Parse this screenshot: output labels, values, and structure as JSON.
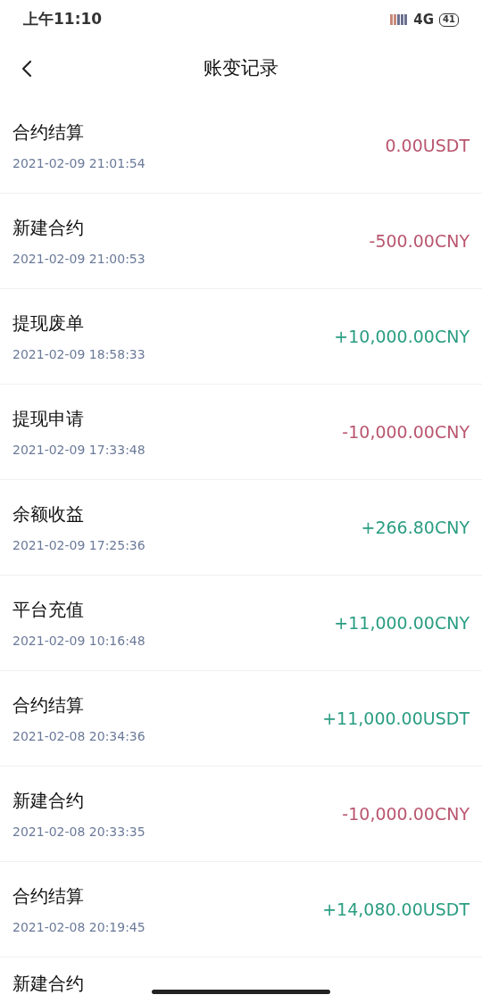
{
  "status_bar": {
    "time": "上午11:10",
    "network": "4G",
    "battery": "41"
  },
  "header": {
    "title": "账变记录"
  },
  "records": [
    {
      "title": "合约结算",
      "time": "2021-02-09 21:01:54",
      "amount": "0.00USDT",
      "color": "#b9566f"
    },
    {
      "title": "新建合约",
      "time": "2021-02-09 21:00:53",
      "amount": "-500.00CNY",
      "color": "#b9566f"
    },
    {
      "title": "提现废单",
      "time": "2021-02-09 18:58:33",
      "amount": "+10,000.00CNY",
      "color": "#2a9d82"
    },
    {
      "title": "提现申请",
      "time": "2021-02-09 17:33:48",
      "amount": "-10,000.00CNY",
      "color": "#b9566f"
    },
    {
      "title": "余额收益",
      "time": "2021-02-09 17:25:36",
      "amount": "+266.80CNY",
      "color": "#2a9d82"
    },
    {
      "title": "平台充值",
      "time": "2021-02-09 10:16:48",
      "amount": "+11,000.00CNY",
      "color": "#2a9d82"
    },
    {
      "title": "合约结算",
      "time": "2021-02-08 20:34:36",
      "amount": "+11,000.00USDT",
      "color": "#2a9d82"
    },
    {
      "title": "新建合约",
      "time": "2021-02-08 20:33:35",
      "amount": "-10,000.00CNY",
      "color": "#b9566f"
    },
    {
      "title": "合约结算",
      "time": "2021-02-08 20:19:45",
      "amount": "+14,080.00USDT",
      "color": "#2a9d82"
    },
    {
      "title": "新建合约"
    }
  ]
}
